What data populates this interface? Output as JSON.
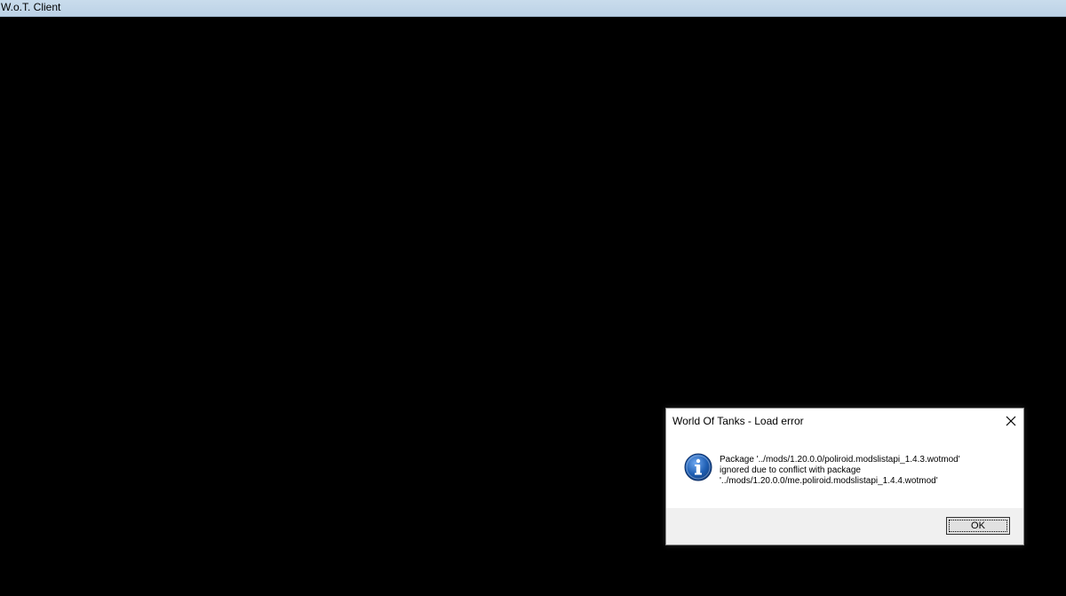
{
  "window": {
    "title": "W.o.T. Client"
  },
  "dialog": {
    "title": "World Of Tanks - Load error",
    "icon": "info-icon",
    "message_lines": [
      "Package '../mods/1.20.0.0/poliroid.modslistapi_1.4.3.wotmod'",
      "ignored due to conflict with package",
      "'../mods/1.20.0.0/me.poliroid.modslistapi_1.4.4.wotmod'"
    ],
    "ok_label": "OK"
  },
  "colors": {
    "background": "#000000",
    "title_bar": "#bcd2e6",
    "dialog_footer": "#f0f0f0",
    "info_icon_blue": "#1f5fb4"
  }
}
